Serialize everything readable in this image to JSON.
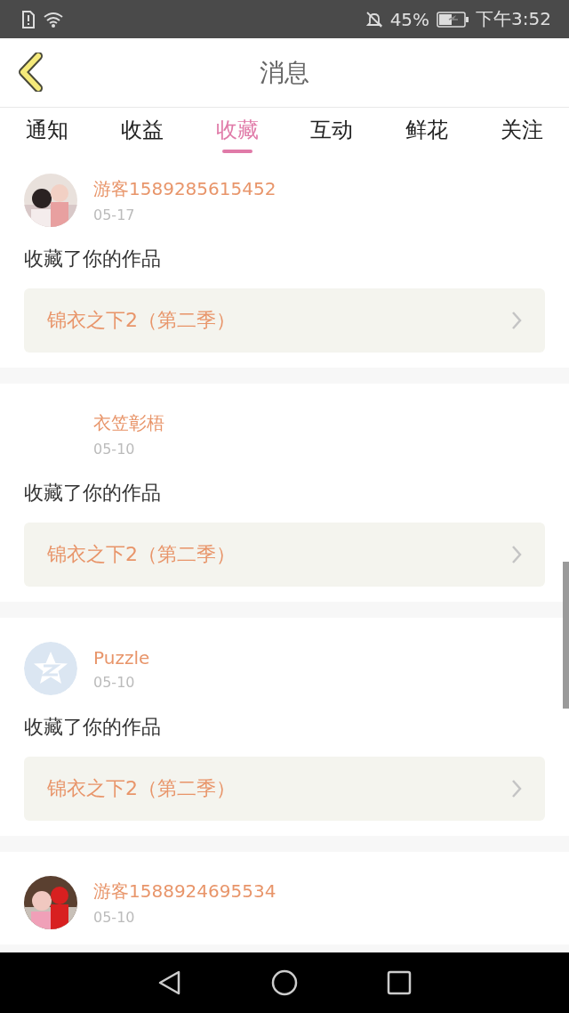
{
  "status_bar": {
    "battery": "45%",
    "time": "下午3:52"
  },
  "header": {
    "title": "消息"
  },
  "tabs": [
    {
      "label": "通知",
      "selected": false
    },
    {
      "label": "收益",
      "selected": false
    },
    {
      "label": "收藏",
      "selected": true
    },
    {
      "label": "互动",
      "selected": false
    },
    {
      "label": "鲜花",
      "selected": false
    },
    {
      "label": "关注",
      "selected": false
    }
  ],
  "messages": [
    {
      "name": "游客1589285615452",
      "date": "05-17",
      "action": "收藏了你的作品",
      "work": "锦衣之下2（第二季）"
    },
    {
      "kind": "blank",
      "name": "衣笠彰梧",
      "date": "05-10",
      "action": "收藏了你的作品",
      "work": "锦衣之下2（第二季）"
    },
    {
      "kind": "default",
      "name": "Puzzle",
      "date": "05-10",
      "action": "收藏了你的作品",
      "work": "锦衣之下2（第二季）"
    },
    {
      "name": "游客1588924695534",
      "date": "05-10"
    }
  ]
}
